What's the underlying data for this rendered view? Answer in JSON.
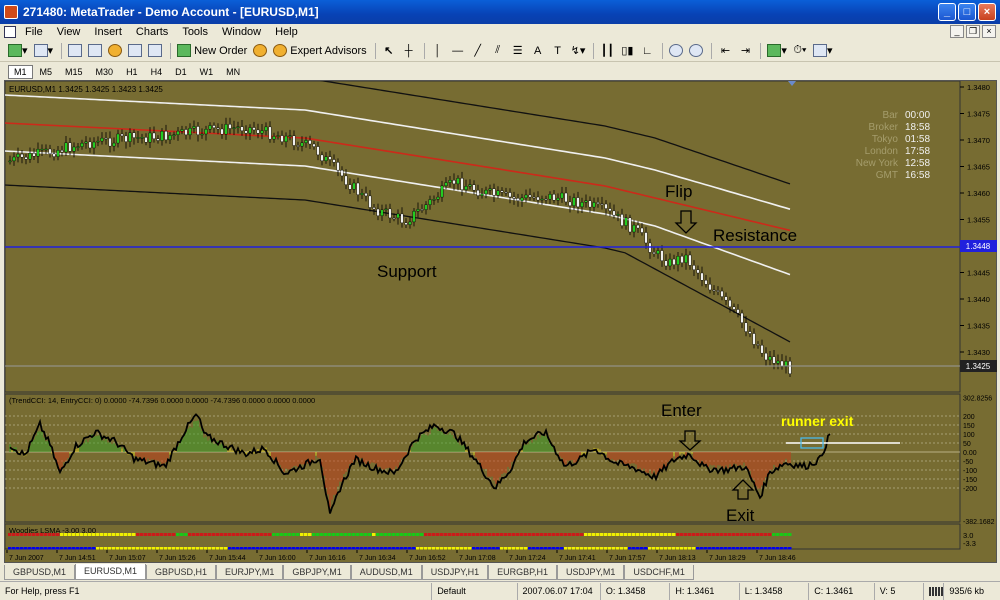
{
  "window": {
    "title": "271480: MetaTrader - Demo Account - [EURUSD,M1]"
  },
  "menu": [
    "File",
    "View",
    "Insert",
    "Charts",
    "Tools",
    "Window",
    "Help"
  ],
  "toolbar": {
    "new_order": "New Order",
    "expert_advisors": "Expert Advisors"
  },
  "timeframes": [
    "M1",
    "M5",
    "M15",
    "M30",
    "H1",
    "H4",
    "D1",
    "W1",
    "MN"
  ],
  "active_timeframe": "M1",
  "chart": {
    "info": "EURUSD,M1  1.3425 1.3425 1.3423 1.3425",
    "price_ticks": [
      "1.3480",
      "1.3475",
      "1.3470",
      "1.3465",
      "1.3460",
      "1.3455",
      "1.3450",
      "1.3445",
      "1.3440",
      "1.3435",
      "1.3430"
    ],
    "hline_label": "1.3448",
    "last_price_label": "1.3425",
    "clock": {
      "labels": [
        "Bar",
        "Broker",
        "Tokyo",
        "London",
        "New York",
        "GMT"
      ],
      "values": [
        "00:00",
        "18:58",
        "01:58",
        "17:58",
        "12:58",
        "16:58"
      ]
    },
    "annotations": {
      "support": "Support",
      "resistance": "Resistance",
      "flip": "Flip",
      "enter": "Enter",
      "exit": "Exit",
      "runner_exit": "runner exit"
    },
    "cci_info": "(TrendCCI: 14, EntryCCI: 0)  0.0000 -74.7396 0.0000 0.0000 -74.7396 0.0000 0.0000 0.0000",
    "cci_ticks": [
      "302.8256",
      "200",
      "150",
      "100",
      "50",
      "0.00",
      "-50",
      "-100",
      "-150",
      "-200",
      "-382.1682"
    ],
    "lsma_info": "Woodies LSMA -3.00 3.00",
    "lsma_ticks": [
      "3.0",
      "-3.3"
    ],
    "time_ticks": [
      "7 Jun 2007",
      "7 Jun 14:51",
      "7 Jun 15:07",
      "7 Jun 15:26",
      "7 Jun 15:44",
      "7 Jun 16:00",
      "7 Jun 16:16",
      "7 Jun 16:34",
      "7 Jun 16:52",
      "7 Jun 17:08",
      "7 Jun 17:24",
      "7 Jun 17:41",
      "7 Jun 17:57",
      "7 Jun 18:13",
      "7 Jun 18:29",
      "7 Jun 18:46"
    ]
  },
  "tabs": [
    "GBPUSD,M1",
    "EURUSD,M1",
    "GBPUSD,H1",
    "EURJPY,M1",
    "GBPJPY,M1",
    "AUDUSD,M1",
    "USDJPY,H1",
    "EURGBP,H1",
    "USDJPY,M1",
    "USDCHF,M1"
  ],
  "active_tab": "EURUSD,M1",
  "status": {
    "help": "For Help, press F1",
    "profile": "Default",
    "datetime": "2007.06.07 17:04",
    "open": "O: 1.3458",
    "high": "H: 1.3461",
    "low": "L: 1.3458",
    "close": "C: 1.3461",
    "volume": "V: 5",
    "traffic": "935/6 kb"
  },
  "colors": {
    "chart_bg": "#776c32",
    "up_candle": "#22cc22",
    "down_candle": "#f0f0f0",
    "ma_red": "#cc2a1a",
    "band_white": "#f0f0f0",
    "band_black": "#111111",
    "hline": "#2020dd",
    "cci_line": "#000000",
    "hist_red": "#c43a1a",
    "hist_green": "#3aa02a",
    "hist_yellow": "#d8c820",
    "annotation_yellow": "#ffff00"
  }
}
